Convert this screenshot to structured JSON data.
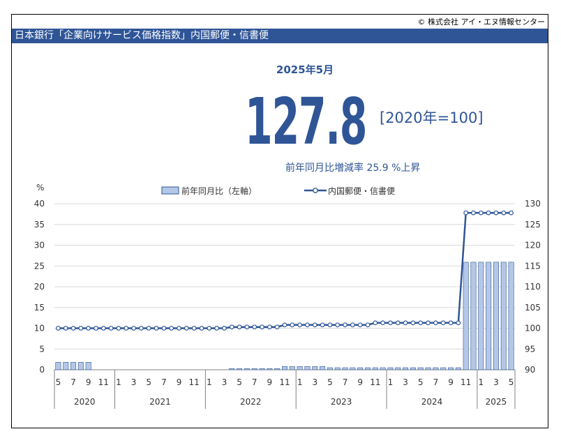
{
  "copyright": "© 株式会社 アイ・エヌ情報センター",
  "header_title": "日本銀行「企業向けサービス価格指数」内国郵便・信書便",
  "headline": {
    "period": "2025年5月",
    "value": "127.8",
    "base": "[2020年=100]",
    "yoy_text": "前年同月比増減率 25.9 %上昇"
  },
  "colors": {
    "accent": "#2F5597",
    "bar_fill": "#B4C7E7",
    "bar_stroke": "#2F5597"
  },
  "chart_data": {
    "type": "bar+line",
    "left_axis": {
      "unit": "%",
      "ylim": [
        0,
        40
      ],
      "ticks": [
        0,
        5,
        10,
        15,
        20,
        25,
        30,
        35,
        40
      ]
    },
    "right_axis": {
      "ylim": [
        90,
        130
      ],
      "ticks": [
        90,
        95,
        100,
        105,
        110,
        115,
        120,
        125,
        130
      ]
    },
    "legend": {
      "placement": "top",
      "bar_label": "前年同月比（左軸）",
      "line_label": "内国郵便・信書便"
    },
    "x_tick_labels": [
      "5",
      "7",
      "9",
      "11",
      "1",
      "3",
      "5",
      "7",
      "9",
      "11",
      "1",
      "3",
      "5",
      "7",
      "9",
      "11",
      "1",
      "3",
      "5",
      "7",
      "9",
      "11",
      "1",
      "3",
      "5",
      "7",
      "9",
      "11",
      "1",
      "3",
      "5"
    ],
    "year_groups": [
      {
        "label": "2020",
        "months": 8
      },
      {
        "label": "2021",
        "months": 12
      },
      {
        "label": "2022",
        "months": 12
      },
      {
        "label": "2023",
        "months": 12
      },
      {
        "label": "2024",
        "months": 12
      },
      {
        "label": "2025",
        "months": 5
      }
    ],
    "months": [
      "2020-05",
      "2020-06",
      "2020-07",
      "2020-08",
      "2020-09",
      "2020-10",
      "2020-11",
      "2020-12",
      "2021-01",
      "2021-02",
      "2021-03",
      "2021-04",
      "2021-05",
      "2021-06",
      "2021-07",
      "2021-08",
      "2021-09",
      "2021-10",
      "2021-11",
      "2021-12",
      "2022-01",
      "2022-02",
      "2022-03",
      "2022-04",
      "2022-05",
      "2022-06",
      "2022-07",
      "2022-08",
      "2022-09",
      "2022-10",
      "2022-11",
      "2022-12",
      "2023-01",
      "2023-02",
      "2023-03",
      "2023-04",
      "2023-05",
      "2023-06",
      "2023-07",
      "2023-08",
      "2023-09",
      "2023-10",
      "2023-11",
      "2023-12",
      "2024-01",
      "2024-02",
      "2024-03",
      "2024-04",
      "2024-05",
      "2024-06",
      "2024-07",
      "2024-08",
      "2024-09",
      "2024-10",
      "2024-11",
      "2024-12",
      "2025-01",
      "2025-02",
      "2025-03",
      "2025-04",
      "2025-05"
    ],
    "series": [
      {
        "name": "前年同月比（左軸）",
        "type": "bar",
        "values": [
          1.8,
          1.8,
          1.8,
          1.8,
          1.8,
          0,
          0,
          0,
          0,
          0,
          0,
          0,
          0,
          0,
          0,
          0,
          0,
          0,
          0,
          0,
          0,
          0,
          0,
          0.3,
          0.3,
          0.3,
          0.3,
          0.3,
          0.3,
          0.3,
          0.8,
          0.8,
          0.8,
          0.8,
          0.8,
          0.8,
          0.5,
          0.5,
          0.5,
          0.5,
          0.5,
          0.5,
          0.5,
          0.5,
          0.5,
          0.5,
          0.5,
          0.5,
          0.5,
          0.5,
          0.5,
          0.5,
          0.5,
          0.5,
          25.9,
          25.9,
          25.9,
          25.9,
          25.9,
          25.9,
          25.9
        ]
      },
      {
        "name": "内国郵便・信書便",
        "type": "line",
        "values": [
          100,
          100,
          100,
          100,
          100,
          100,
          100,
          100,
          100,
          100,
          100,
          100,
          100,
          100,
          100,
          100,
          100,
          100,
          100,
          100,
          100,
          100,
          100,
          100.3,
          100.3,
          100.3,
          100.3,
          100.3,
          100.3,
          100.3,
          100.8,
          100.8,
          100.8,
          100.8,
          100.8,
          100.8,
          100.8,
          100.8,
          100.8,
          100.8,
          100.8,
          100.8,
          101.3,
          101.3,
          101.3,
          101.3,
          101.3,
          101.3,
          101.3,
          101.3,
          101.3,
          101.3,
          101.3,
          101.3,
          127.8,
          127.8,
          127.8,
          127.8,
          127.8,
          127.8,
          127.8
        ]
      }
    ]
  }
}
